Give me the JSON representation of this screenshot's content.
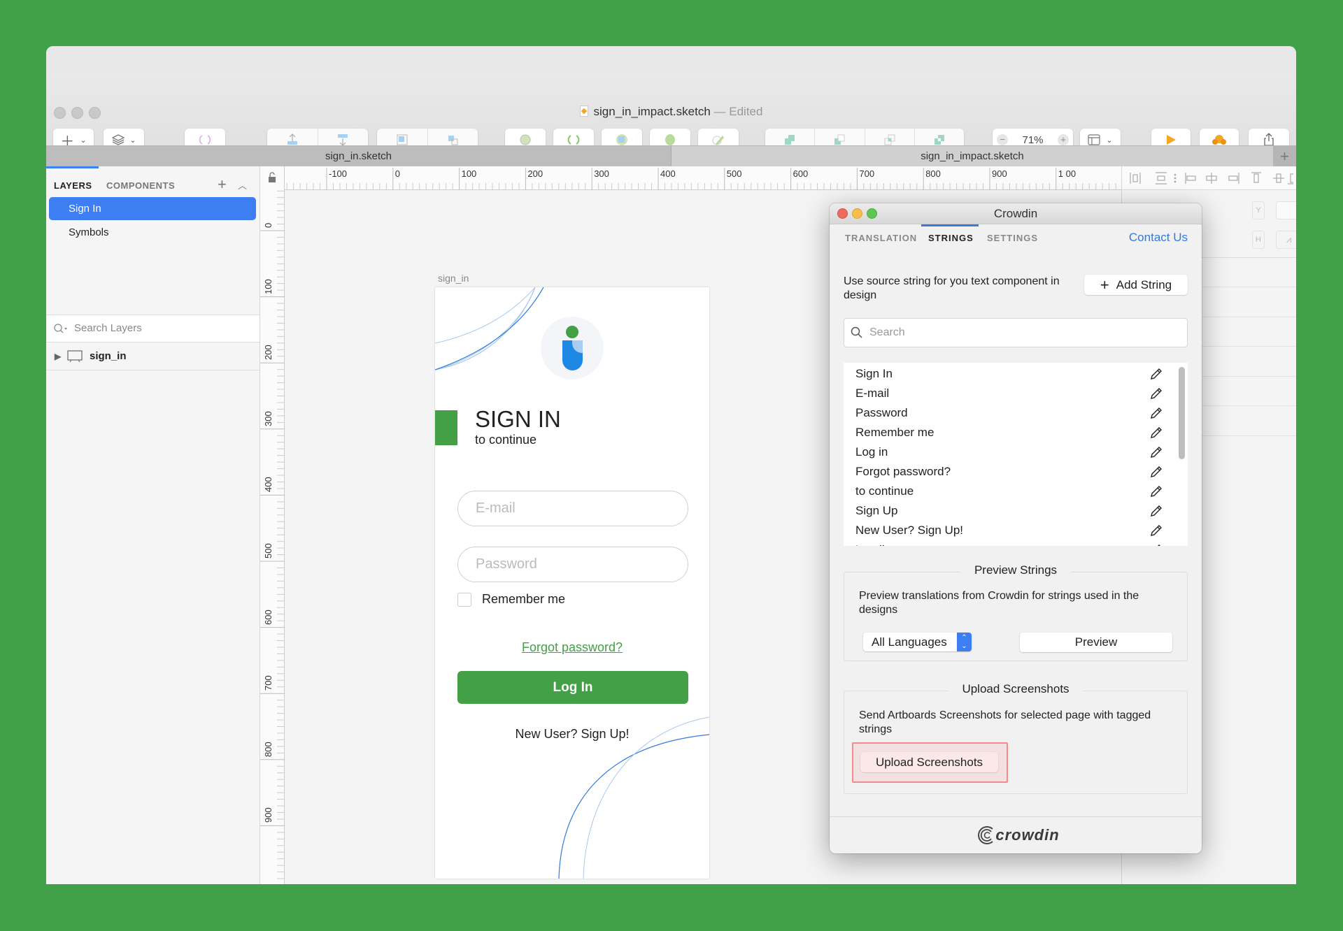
{
  "window": {
    "title": "sign_in_impact.sketch",
    "title_status": "— Edited"
  },
  "toolbar": {
    "insert": "Insert",
    "data": "Data",
    "create_symbol": "Create Symbol",
    "forward": "Forward",
    "backward": "Backward",
    "group": "Group",
    "ungroup": "Ungroup",
    "edit": "Edit",
    "rotate": "Rotate",
    "mask": "Mask",
    "scale": "Scale",
    "flatten": "Flatten",
    "union": "Union",
    "subtract": "Subtract",
    "intersect": "Intersect",
    "difference": "Difference",
    "zoom_label": "Zoom",
    "zoom_value": "71%",
    "view": "View",
    "preview": "Preview",
    "cloud": "Cloud",
    "export": "Export"
  },
  "tabs": {
    "tab1": "sign_in.sketch",
    "tab2": "sign_in_impact.sketch",
    "add": "+"
  },
  "left_panel": {
    "tab_layers": "LAYERS",
    "tab_components": "COMPONENTS",
    "pages": [
      "Sign In",
      "Symbols"
    ],
    "search_placeholder": "Search Layers",
    "layer": "sign_in"
  },
  "canvas": {
    "h_ruler": [
      "-100",
      "0",
      "100",
      "200",
      "300",
      "400",
      "500",
      "600",
      "700",
      "800",
      "900",
      "1 00"
    ],
    "v_ruler": [
      "0",
      "100",
      "200",
      "300",
      "400",
      "500",
      "600",
      "700",
      "800",
      "900"
    ],
    "artboard_label": "sign_in"
  },
  "artboard": {
    "title": "SIGN IN",
    "subtitle": "to continue",
    "email_placeholder": "E-mail",
    "password_placeholder": "Password",
    "remember": "Remember me",
    "forgot": "Forgot password?",
    "login": "Log In",
    "signup": "New User? Sign Up!",
    "colors": {
      "green": "#43a047",
      "blue": "#1e88e5"
    }
  },
  "inspector": {
    "y_label": "Y",
    "h_label": "H",
    "degree": "°"
  },
  "crowdin": {
    "title": "Crowdin",
    "tabs": [
      "TRANSLATION",
      "STRINGS",
      "SETTINGS"
    ],
    "active_tab": "STRINGS",
    "contact": "Contact Us",
    "description": "Use source string for you text component in design",
    "add_string": "Add String",
    "search_placeholder": "Search",
    "strings": [
      "Sign In",
      "E-mail",
      "Password",
      "Remember me",
      "Log in",
      "Forgot password?",
      "to continue",
      "Sign Up",
      "New User? Sign Up!",
      "Loading"
    ],
    "preview_section": {
      "title": "Preview Strings",
      "text": "Preview translations from Crowdin for strings used in the designs",
      "language": "All Languages",
      "button": "Preview"
    },
    "upload_section": {
      "title": "Upload Screenshots",
      "text": "Send Artboards Screenshots for selected page with tagged strings",
      "button": "Upload Screenshots"
    },
    "logo": "crowdin",
    "accent": "#2f7be0"
  }
}
